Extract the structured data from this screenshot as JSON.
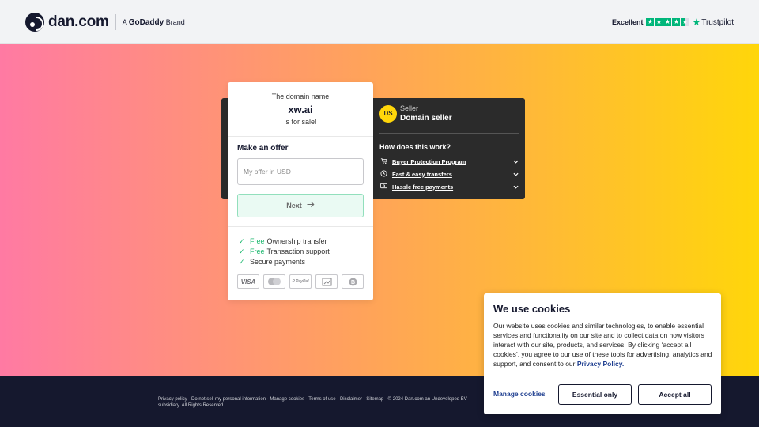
{
  "header": {
    "logo_text": "dan.com",
    "brand_prefix": "A ",
    "brand_name": "GoDaddy",
    "brand_suffix": " Brand",
    "trustpilot": {
      "rating_label": "Excellent",
      "stars": 4.5,
      "name": "Trustpilot"
    }
  },
  "offer": {
    "intro": "The domain name",
    "domain": "xw.ai",
    "for_sale": "is for sale!",
    "make_offer_label": "Make an offer",
    "input_placeholder": "My offer in USD",
    "next_label": "Next",
    "benefits": [
      {
        "free": "Free",
        "text": "Ownership transfer"
      },
      {
        "free": "Free",
        "text": "Transaction support"
      },
      {
        "free": "",
        "text": "Secure payments"
      }
    ],
    "payment_methods": [
      "VISA",
      "mastercard",
      "PayPal",
      "bank-transfer",
      "bitcoin"
    ]
  },
  "seller": {
    "initials": "DS",
    "label": "Seller",
    "name": "Domain seller",
    "how_title": "How does this work?",
    "items": [
      {
        "icon": "cart-icon",
        "label": "Buyer Protection Program"
      },
      {
        "icon": "clock-icon",
        "label": "Fast & easy transfers"
      },
      {
        "icon": "payment-icon",
        "label": "Hassle free payments"
      }
    ]
  },
  "footer": {
    "text": "Privacy policy · Do not sell my personal information · Manage cookies · Terms of use · Disclaimer · Sitemap · © 2024 Dan.com an Undeveloped BV subsidiary. All Rights Reserved."
  },
  "cookies": {
    "title": "We use cookies",
    "body": "Our website uses cookies and similar technologies, to enable essential services and functionality on our site and to collect data on how visitors interact with our site, products, and services. By clicking ‘accept all cookies’, you agree to our use of these tools for advertising, analytics and support, and consent to our ",
    "policy_link": "Privacy Policy",
    "body_end": ".",
    "manage_label": "Manage cookies",
    "essential_label": "Essential only",
    "accept_label": "Accept all"
  },
  "colors": {
    "gradient_start": "#ff7aa3",
    "gradient_mid": "#ffa35a",
    "gradient_end": "#ffd60a",
    "footer_bg": "#15182e",
    "accent_green": "#1cb76e"
  }
}
